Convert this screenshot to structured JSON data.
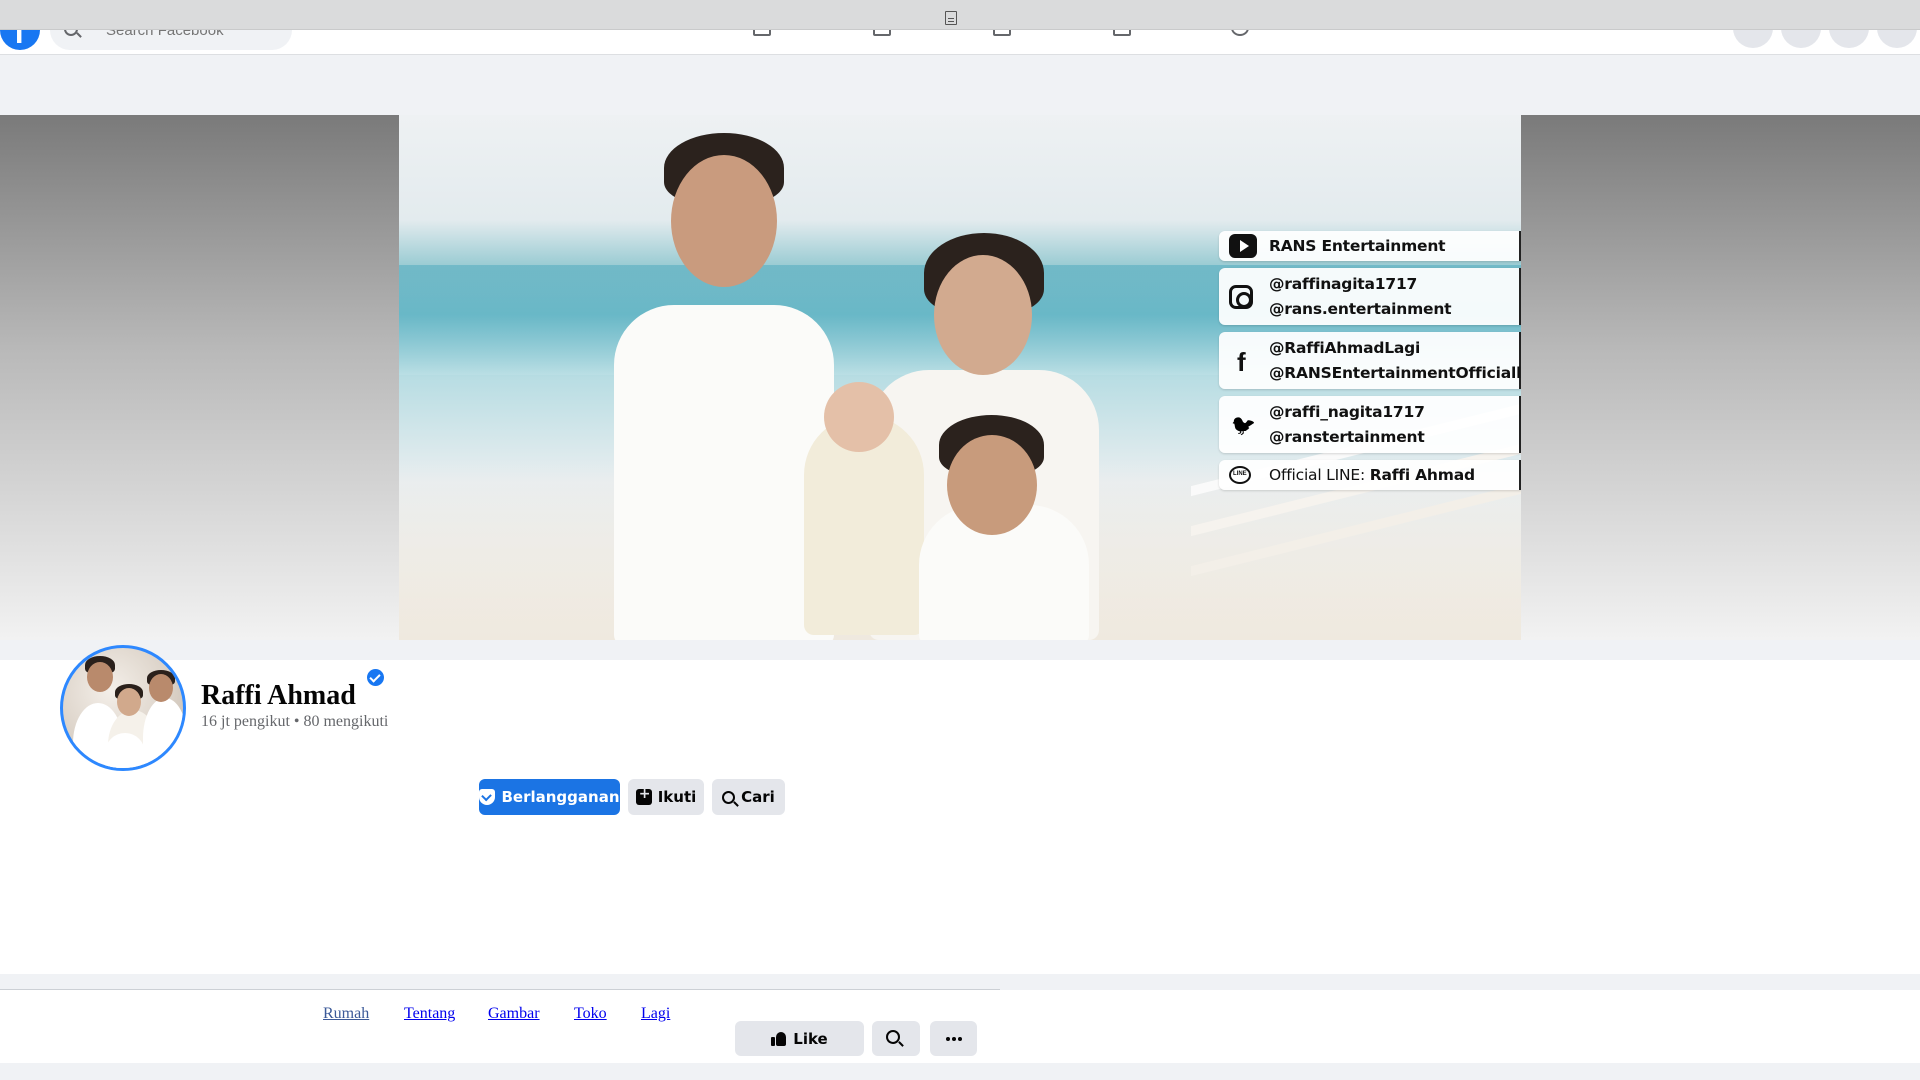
{
  "topnav": {
    "search_placeholder": "Search Facebook"
  },
  "cover": {
    "social_links": [
      {
        "icon": "youtube-icon",
        "lines": [
          "RANS Entertainment"
        ]
      },
      {
        "icon": "instagram-icon",
        "lines": [
          "@raffinagita1717",
          "@rans.entertainment"
        ]
      },
      {
        "icon": "facebook-icon",
        "lines": [
          "@RaffiAhmadLagi",
          "@RANSEntertainmentOfficially"
        ]
      },
      {
        "icon": "twitter-icon",
        "lines": [
          "@raffi_nagita1717",
          "@ranstertainment"
        ]
      },
      {
        "icon": "line-icon",
        "prefix": "Official LINE: ",
        "lines": [
          "Raffi Ahmad"
        ]
      }
    ]
  },
  "profile": {
    "name": "Raffi Ahmad",
    "stats": "16 jt pengikut • 80 mengikuti",
    "buttons": {
      "subscribe": "Berlangganan",
      "follow": "Ikuti",
      "search": "Cari"
    }
  },
  "tabs": {
    "items": [
      "Rumah",
      "Tentang",
      "Gambar",
      "Toko",
      "Lagi"
    ],
    "like_label": "Like"
  },
  "colors": {
    "accent": "#1b74e4",
    "verified": "#1877f2"
  }
}
